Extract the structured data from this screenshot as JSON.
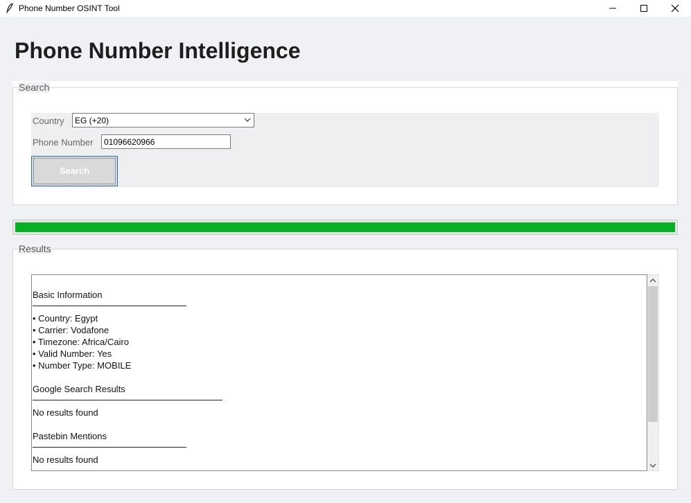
{
  "window": {
    "title": "Phone Number OSINT Tool",
    "icon": "feather-icon",
    "controls": [
      "minimize-icon",
      "maximize-icon",
      "close-icon"
    ]
  },
  "page": {
    "heading": "Phone Number Intelligence"
  },
  "search": {
    "legend": "Search",
    "country_label": "Country",
    "country_value": "EG (+20)",
    "phone_label": "Phone Number",
    "phone_value": "01096620966",
    "button_label": "Search"
  },
  "progress": {
    "value_percent": 100,
    "color": "#06b025"
  },
  "results": {
    "legend": "Results",
    "sections": [
      {
        "title": "Basic Information",
        "lines": [
          "• Country: Egypt",
          "• Carrier: Vodafone",
          "• Timezone: Africa/Cairo",
          "• Valid Number: Yes",
          "• Number Type: MOBILE"
        ]
      },
      {
        "title": "Google Search Results",
        "lines": [
          "No results found"
        ]
      },
      {
        "title": "Pastebin Mentions",
        "lines": [
          "No results found"
        ]
      }
    ]
  },
  "colors": {
    "background": "#f0f1f4",
    "accent_border": "#1f6fd1"
  }
}
